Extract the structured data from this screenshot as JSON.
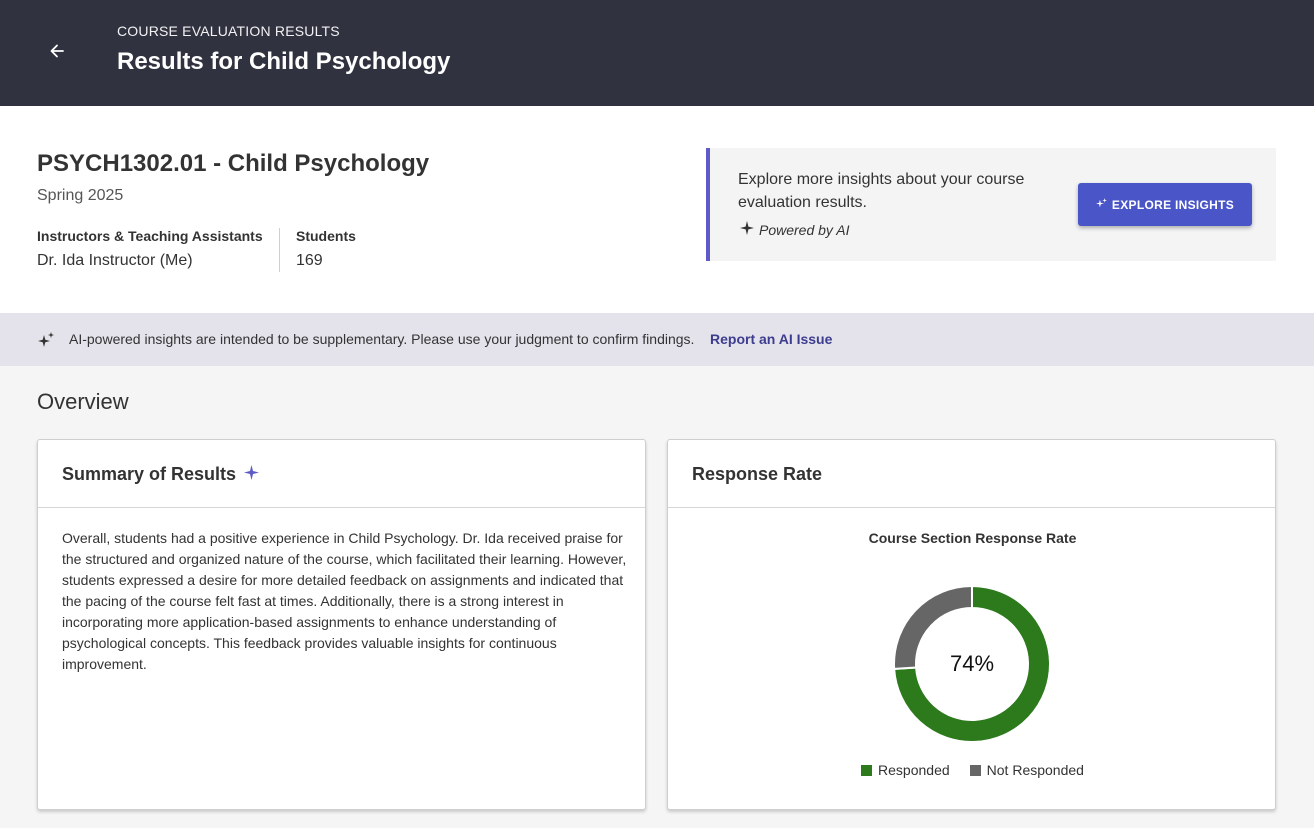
{
  "header": {
    "kicker": "COURSE EVALUATION RESULTS",
    "title": "Results for Child Psychology",
    "back_icon": "arrow-left-icon"
  },
  "course": {
    "title": "PSYCH1302.01 - Child Psychology",
    "term": "Spring 2025",
    "instructors_label": "Instructors & Teaching Assistants",
    "instructors_value": "Dr. Ida Instructor (Me)",
    "students_label": "Students",
    "students_value": "169"
  },
  "insights": {
    "text": "Explore more insights about your course evaluation results.",
    "powered_by": "Powered by AI",
    "button_label": "EXPLORE INSIGHTS",
    "accent_color": "#5e5bc8",
    "button_color": "#4a56c8"
  },
  "ai_banner": {
    "text": "AI-powered insights are intended to be supplementary. Please use your judgment to confirm findings.",
    "link": "Report an AI Issue"
  },
  "overview": {
    "title": "Overview"
  },
  "summary": {
    "title": "Summary of Results",
    "body": "Overall, students had a positive experience in Child Psychology. Dr. Ida received praise for the structured and organized nature of the course, which facilitated their learning. However, students expressed a desire for more detailed feedback on assignments and indicated that the pacing of the course felt fast at times. Additionally, there is a strong interest in incorporating more application-based assignments to enhance understanding of psychological concepts. This feedback provides valuable insights for continuous improvement."
  },
  "response": {
    "title": "Response Rate",
    "chart_title": "Course Section Response Rate",
    "center_label": "74%",
    "legend": [
      {
        "label": "Responded",
        "color": "#2c7a1c"
      },
      {
        "label": "Not Responded",
        "color": "#666666"
      }
    ]
  },
  "chart_data": {
    "type": "pie",
    "title": "Course Section Response Rate",
    "categories": [
      "Responded",
      "Not Responded"
    ],
    "values": [
      74,
      26
    ],
    "colors": [
      "#2c7a1c",
      "#666666"
    ],
    "legend": "bottom"
  }
}
